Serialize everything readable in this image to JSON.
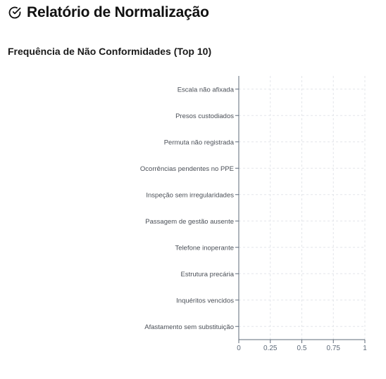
{
  "header": {
    "icon": "check-circle-icon",
    "title": "Relatório de Normalização"
  },
  "section": {
    "title": "Frequência de Não Conformidades (Top 10)"
  },
  "colors": {
    "axis": "#5f6b7a",
    "grid": "#e3e6ea",
    "label": "#4a4f57",
    "bar": "#3b82f6"
  },
  "chart_data": {
    "type": "bar",
    "orientation": "horizontal",
    "categories": [
      "Escala não afixada",
      "Presos custodiados",
      "Permuta não registrada",
      "Ocorrências pendentes no PPE",
      "Inspeção sem irregularidades",
      "Passagem de gestão ausente",
      "Telefone inoperante",
      "Estrutura precária",
      "Inquéritos vencidos",
      "Afastamento sem substituição"
    ],
    "values": [
      0,
      0,
      0,
      0,
      0,
      0,
      0,
      0,
      0,
      0
    ],
    "xlim": [
      0,
      1
    ],
    "xticks": [
      "0",
      "0.25",
      "0.5",
      "0.75",
      "1"
    ],
    "grid": true
  }
}
